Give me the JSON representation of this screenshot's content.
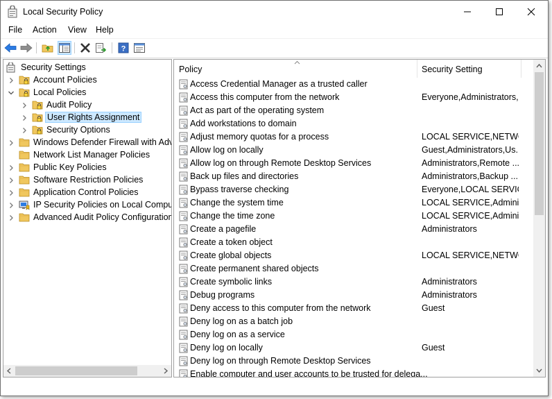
{
  "window": {
    "title": "Local Security Policy"
  },
  "menu": [
    "File",
    "Action",
    "View",
    "Help"
  ],
  "toolbar": {
    "icons": [
      "back-arrow-icon",
      "forward-arrow-icon",
      "up-folder-icon",
      "show-hide-tree-icon",
      "delete-icon",
      "export-list-icon",
      "help-icon",
      "properties-icon"
    ]
  },
  "tree": {
    "items": [
      {
        "label": "Security Settings",
        "expand": "none",
        "indent": 0,
        "icon": "security-settings-icon"
      },
      {
        "label": "Account Policies",
        "expand": "collapsed",
        "indent": 1,
        "icon": "policy-folder-icon"
      },
      {
        "label": "Local Policies",
        "expand": "expanded",
        "indent": 1,
        "icon": "policy-folder-icon"
      },
      {
        "label": "Audit Policy",
        "expand": "collapsed",
        "indent": 2,
        "icon": "policy-folder-icon"
      },
      {
        "label": "User Rights Assignment",
        "expand": "collapsed",
        "indent": 2,
        "icon": "policy-folder-icon",
        "selected": true
      },
      {
        "label": "Security Options",
        "expand": "collapsed",
        "indent": 2,
        "icon": "policy-folder-icon"
      },
      {
        "label": "Windows Defender Firewall with Adva",
        "expand": "collapsed",
        "indent": 1,
        "icon": "folder-icon"
      },
      {
        "label": "Network List Manager Policies",
        "expand": "none",
        "indent": 1,
        "icon": "folder-icon"
      },
      {
        "label": "Public Key Policies",
        "expand": "collapsed",
        "indent": 1,
        "icon": "folder-icon"
      },
      {
        "label": "Software Restriction Policies",
        "expand": "collapsed",
        "indent": 1,
        "icon": "folder-icon"
      },
      {
        "label": "Application Control Policies",
        "expand": "collapsed",
        "indent": 1,
        "icon": "folder-icon"
      },
      {
        "label": "IP Security Policies on Local Compute",
        "expand": "collapsed",
        "indent": 1,
        "icon": "ip-security-icon"
      },
      {
        "label": "Advanced Audit Policy Configuration",
        "expand": "collapsed",
        "indent": 1,
        "icon": "folder-icon"
      }
    ]
  },
  "list": {
    "columns": {
      "policy": "Policy",
      "setting": "Security Setting"
    },
    "rows": [
      {
        "policy": "Access Credential Manager as a trusted caller",
        "setting": ""
      },
      {
        "policy": "Access this computer from the network",
        "setting": "Everyone,Administrators,..."
      },
      {
        "policy": "Act as part of the operating system",
        "setting": ""
      },
      {
        "policy": "Add workstations to domain",
        "setting": ""
      },
      {
        "policy": "Adjust memory quotas for a process",
        "setting": "LOCAL SERVICE,NETWO..."
      },
      {
        "policy": "Allow log on locally",
        "setting": "Guest,Administrators,Us..."
      },
      {
        "policy": "Allow log on through Remote Desktop Services",
        "setting": "Administrators,Remote ..."
      },
      {
        "policy": "Back up files and directories",
        "setting": "Administrators,Backup ..."
      },
      {
        "policy": "Bypass traverse checking",
        "setting": "Everyone,LOCAL SERVIC..."
      },
      {
        "policy": "Change the system time",
        "setting": "LOCAL SERVICE,Admini..."
      },
      {
        "policy": "Change the time zone",
        "setting": "LOCAL SERVICE,Admini..."
      },
      {
        "policy": "Create a pagefile",
        "setting": "Administrators"
      },
      {
        "policy": "Create a token object",
        "setting": ""
      },
      {
        "policy": "Create global objects",
        "setting": "LOCAL SERVICE,NETWO..."
      },
      {
        "policy": "Create permanent shared objects",
        "setting": ""
      },
      {
        "policy": "Create symbolic links",
        "setting": "Administrators"
      },
      {
        "policy": "Debug programs",
        "setting": "Administrators"
      },
      {
        "policy": "Deny access to this computer from the network",
        "setting": "Guest"
      },
      {
        "policy": "Deny log on as a batch job",
        "setting": ""
      },
      {
        "policy": "Deny log on as a service",
        "setting": ""
      },
      {
        "policy": "Deny log on locally",
        "setting": "Guest"
      },
      {
        "policy": "Deny log on through Remote Desktop Services",
        "setting": ""
      },
      {
        "policy": "Enable computer and user accounts to be trusted for delega...",
        "setting": ""
      }
    ]
  },
  "colors": {
    "selection_bg": "#cce8ff",
    "selection_border": "#99d1ff",
    "accent_blue": "#1a6fc8",
    "folder": "#f0c75e"
  }
}
